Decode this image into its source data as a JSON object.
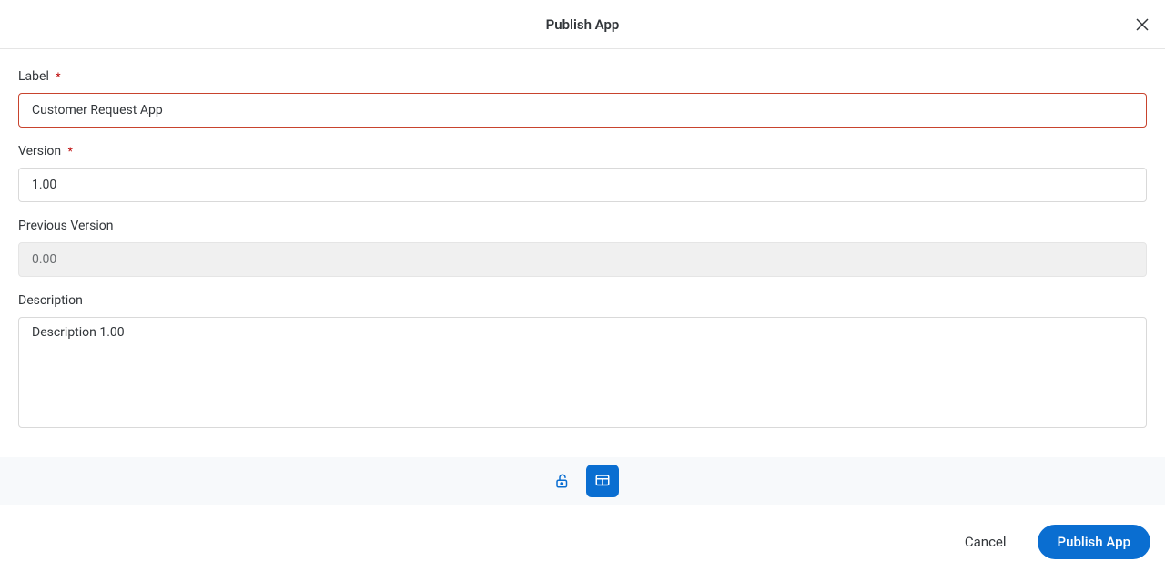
{
  "header": {
    "title": "Publish App"
  },
  "form": {
    "label": {
      "label": "Label",
      "required": true,
      "value": "Customer Request App"
    },
    "version": {
      "label": "Version",
      "required": true,
      "value": "1.00"
    },
    "previousVersion": {
      "label": "Previous Version",
      "required": false,
      "value": "0.00"
    },
    "description": {
      "label": "Description",
      "required": false,
      "value": "Description 1.00"
    }
  },
  "footer": {
    "cancel": "Cancel",
    "publish": "Publish App"
  }
}
